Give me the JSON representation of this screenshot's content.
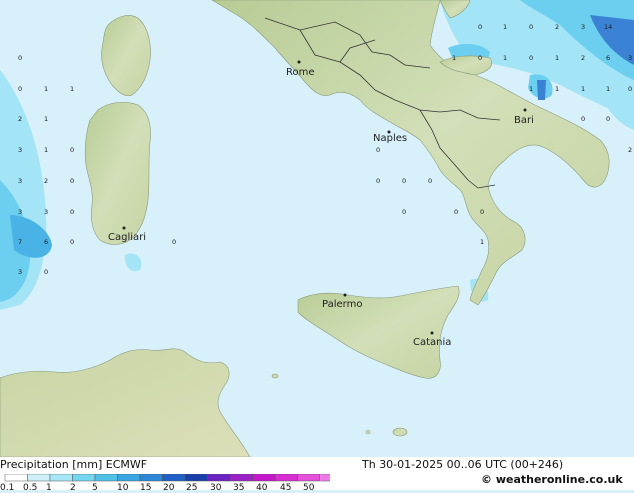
{
  "cities": [
    {
      "name": "Rome"
    },
    {
      "name": "Naples"
    },
    {
      "name": "Bari"
    },
    {
      "name": "Cagliari"
    },
    {
      "name": "Palermo"
    },
    {
      "name": "Catania"
    }
  ],
  "grid_values": [
    "0",
    "1",
    "0",
    "2",
    "3",
    "14",
    "1",
    "0",
    "1",
    "0",
    "1",
    "2",
    "6",
    "3",
    "1",
    "1",
    "1",
    "1",
    "0",
    "0",
    "0",
    "2",
    "0",
    "0",
    "1",
    "1",
    "2",
    "1",
    "3",
    "1",
    "0",
    "0",
    "3",
    "2",
    "0",
    "0",
    "0",
    "0",
    "3",
    "3",
    "0",
    "0",
    "0",
    "0",
    "7",
    "6",
    "0",
    "0",
    "1",
    "3",
    "0"
  ],
  "footer": {
    "title": "Precipitation [mm]  ECMWF",
    "datetime": "Th 30-01-2025 00..06 UTC (00+246)",
    "copyright": "© weatheronline.co.uk"
  },
  "legend": {
    "ticks": [
      "0.1",
      "0.5",
      "1",
      "2",
      "5",
      "10",
      "15",
      "20",
      "25",
      "30",
      "35",
      "40",
      "45",
      "50"
    ],
    "colors": [
      "#fefefe",
      "#cdeff9",
      "#a5e6f7",
      "#74d6f1",
      "#4fc2ea",
      "#39a6e2",
      "#2d87d6",
      "#1f60c6",
      "#1a3ea8",
      "#6d22c3",
      "#9b20c8",
      "#c517c9",
      "#d82dd3",
      "#e64fdc",
      "#ee7ae5"
    ]
  },
  "colors": {
    "sea": "#d8f0fa",
    "land": "#c9d8ae",
    "precip_light": "#a4e4f7",
    "precip_medium": "#5cc5ee",
    "precip_heavy": "#3b82d5"
  }
}
